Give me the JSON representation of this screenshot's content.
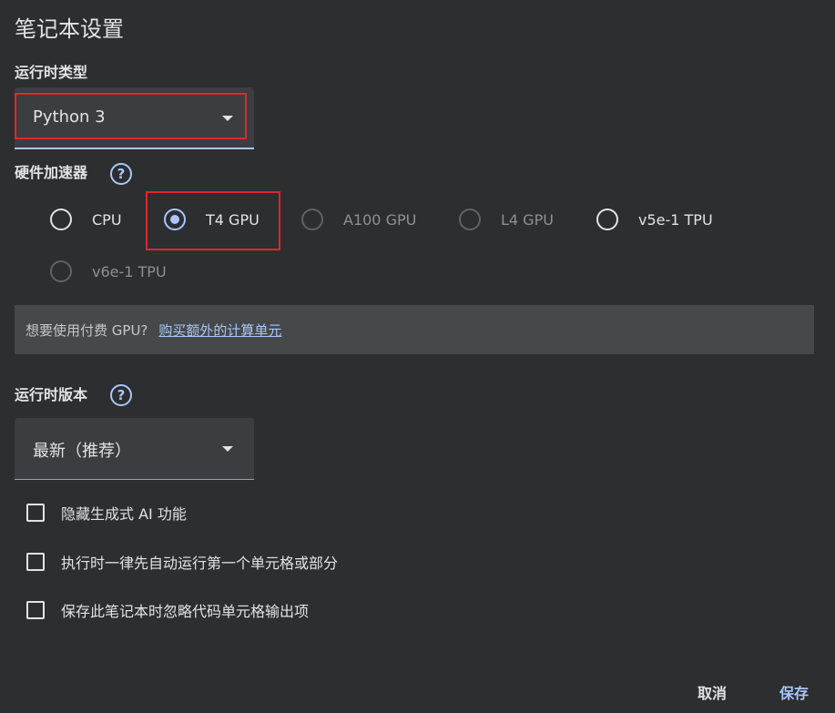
{
  "dialog": {
    "title": "笔记本设置"
  },
  "runtime_type": {
    "label": "运行时类型",
    "selected": "Python 3"
  },
  "hardware_accelerator": {
    "label": "硬件加速器",
    "help_icon": "help-circle-icon",
    "options": [
      {
        "label": "CPU",
        "selected": false,
        "disabled": false
      },
      {
        "label": "T4 GPU",
        "selected": true,
        "disabled": false
      },
      {
        "label": "A100 GPU",
        "selected": false,
        "disabled": true
      },
      {
        "label": "L4 GPU",
        "selected": false,
        "disabled": true
      },
      {
        "label": "v5e-1 TPU",
        "selected": false,
        "disabled": false
      },
      {
        "label": "v6e-1 TPU",
        "selected": false,
        "disabled": true
      }
    ]
  },
  "paid_gpu_banner": {
    "text": "想要使用付费 GPU?",
    "link": "购买额外的计算单元"
  },
  "runtime_version": {
    "label": "运行时版本",
    "help_icon": "help-circle-icon",
    "selected": "最新（推荐）"
  },
  "checkboxes": [
    {
      "label": "隐藏生成式 AI 功能",
      "checked": false
    },
    {
      "label": "执行时一律先自动运行第一个单元格或部分",
      "checked": false
    },
    {
      "label": "保存此笔记本时忽略代码单元格输出项",
      "checked": false
    }
  ],
  "footer": {
    "cancel_label": "取消",
    "save_label": "保存"
  },
  "colors": {
    "background": "#2d2e30",
    "accent": "#a8c7fa",
    "highlight": "#e0262a",
    "banner": "#47484a"
  }
}
